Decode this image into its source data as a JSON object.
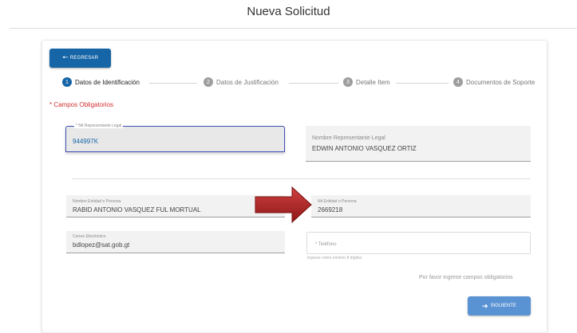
{
  "page": {
    "title": "Nueva Solicitud"
  },
  "toolbar": {
    "back_label": "REGRESAR"
  },
  "steps": [
    {
      "number": "1",
      "label": "Datos de Identificación"
    },
    {
      "number": "2",
      "label": "Datos de Justificación"
    },
    {
      "number": "3",
      "label": "Detalle Item"
    },
    {
      "number": "4",
      "label": "Documentos de Soporte"
    }
  ],
  "form": {
    "required_note": "* Campos Obligatorios",
    "nit_rep": {
      "label": "* Nit Representante Legal",
      "value": "944997K"
    },
    "nombre_rep": {
      "label": "Nombre Representante Legal",
      "value": "EDWIN ANTONIO VASQUEZ ORTIZ"
    },
    "nombre_entidad": {
      "label": "Nombre Entidad o Persona",
      "value": "RABID ANTONIO VASQUEZ FUL MORTUAL"
    },
    "nit_entidad": {
      "label": "Nit Entidad o Persona",
      "value": "2669218"
    },
    "correo": {
      "label": "Correo Electronico",
      "value": "bdlopez@sat.gob.gt"
    },
    "telefono": {
      "placeholder": "* Teléfono",
      "helper": "Ingrese como mínimo 8 dígitos"
    },
    "required_message": "Por favor ingrese campos obligatorios",
    "next_label": "SIGUIENTE"
  },
  "colors": {
    "primary": "#1565a7",
    "next": "#5a93d4",
    "required": "#d32f2f",
    "arrow": "#b71c1c"
  }
}
